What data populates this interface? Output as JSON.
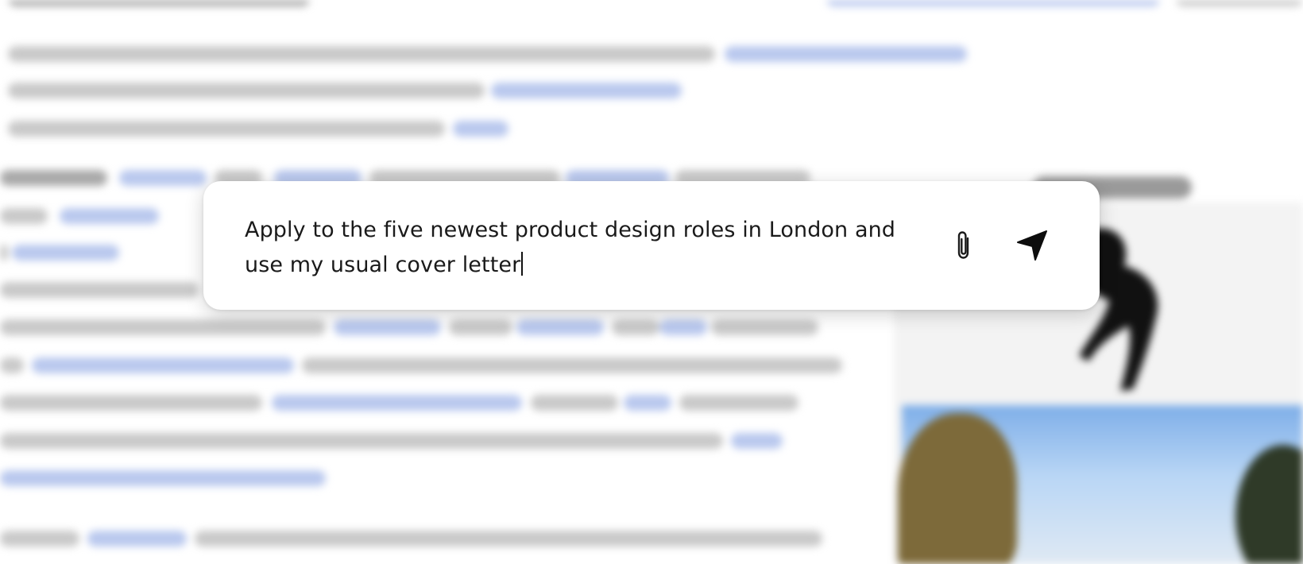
{
  "prompt": {
    "text": "Apply to the five newest product design roles in London and use my usual cover letter"
  },
  "icons": {
    "attach": "paperclip-icon",
    "send": "send-arrow-icon"
  }
}
